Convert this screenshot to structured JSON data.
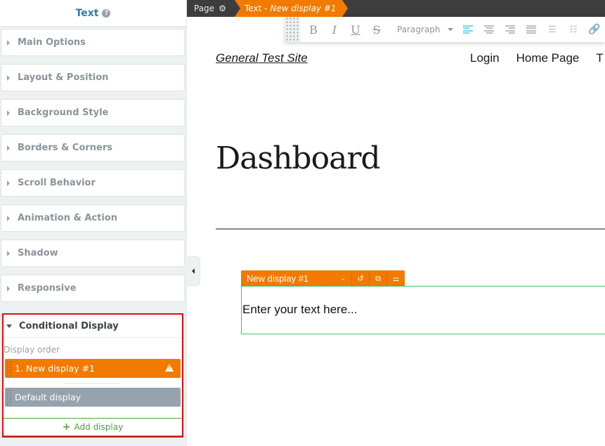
{
  "sidebar": {
    "title": "Text",
    "help_icon": "question-circle-icon",
    "panels": [
      {
        "label": "Main Options"
      },
      {
        "label": "Layout & Position"
      },
      {
        "label": "Background Style"
      },
      {
        "label": "Borders & Corners"
      },
      {
        "label": "Scroll Behavior"
      },
      {
        "label": "Animation & Action"
      },
      {
        "label": "Shadow"
      },
      {
        "label": "Responsive"
      }
    ],
    "conditional": {
      "title": "Conditional Display",
      "display_order_label": "Display order",
      "items": [
        {
          "label": "1. New display #1",
          "warning": true,
          "state": "active"
        },
        {
          "label": "Default display",
          "state": "default"
        }
      ],
      "add_label": "Add display"
    }
  },
  "topbar": {
    "page_label": "Page",
    "crumb_prefix": "Text -",
    "crumb_name": "New display #1"
  },
  "toolbar": {
    "bold": "B",
    "italic": "I",
    "underline": "U",
    "strike": "S",
    "format_value": "Paragraph"
  },
  "site": {
    "title": "General Test Site",
    "nav": [
      "Login",
      "Home Page",
      "T"
    ]
  },
  "page": {
    "heading": "Dashboard"
  },
  "element": {
    "display_select": "New display #1",
    "text": "Enter your text here..."
  },
  "colors": {
    "accent": "#f27a00",
    "link_blue": "#2a7ea6",
    "success_green": "#4aa23a",
    "highlight_red": "#e50b0b"
  }
}
